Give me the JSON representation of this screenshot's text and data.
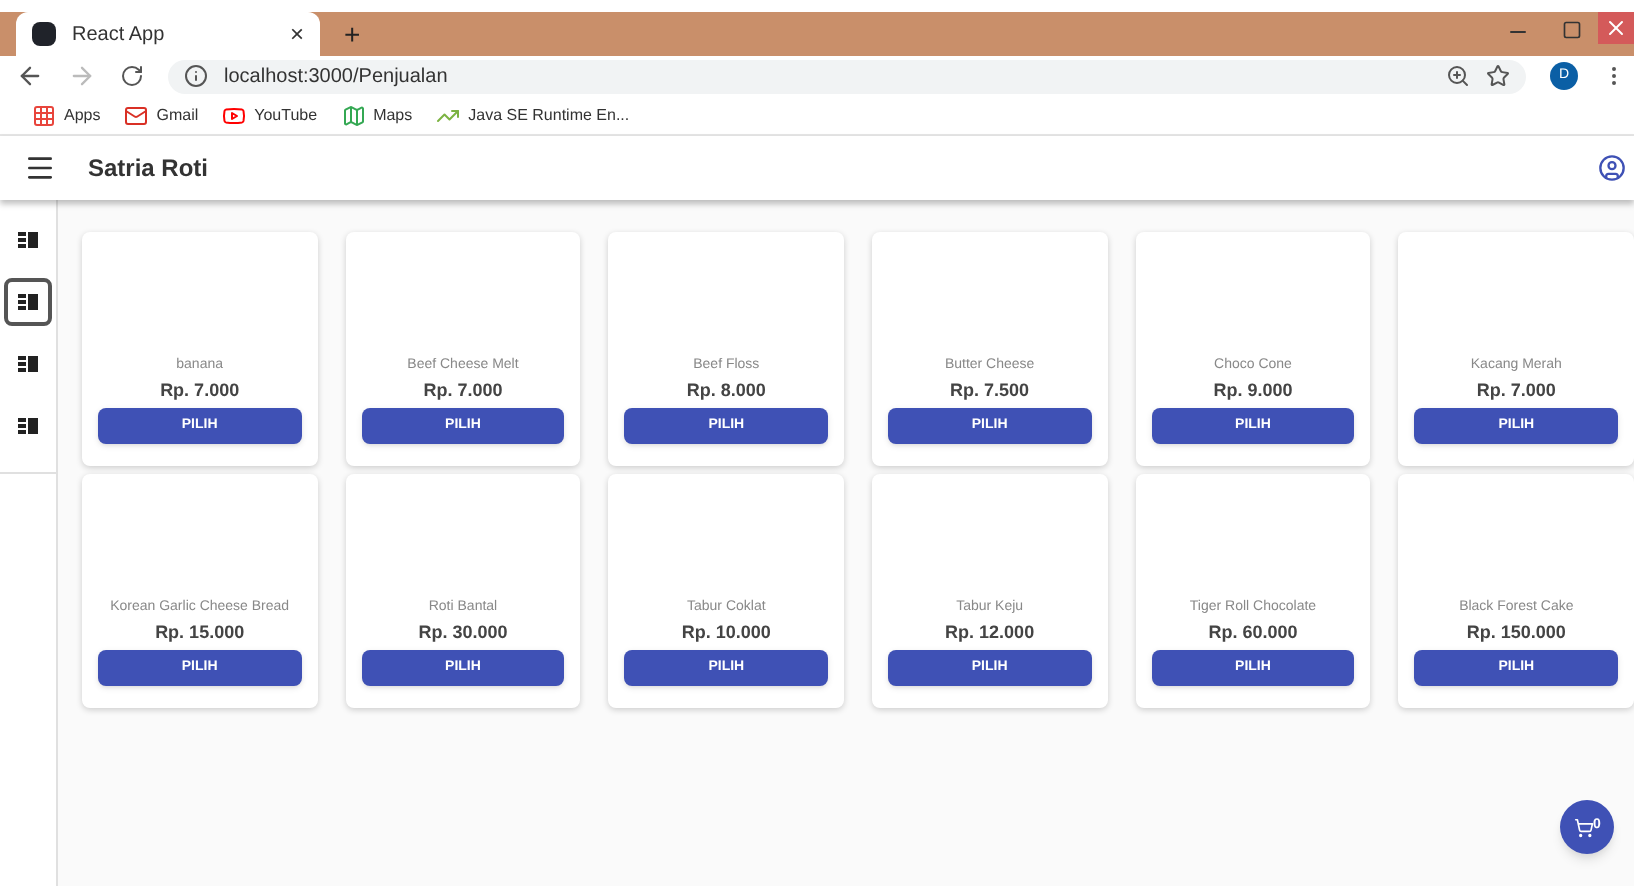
{
  "browser": {
    "tab_title": "React App",
    "tab_close": "×",
    "new_tab": "+",
    "url": "localhost:3000/Penjualan",
    "profile": "D",
    "bookmarks": [
      {
        "kind": "apps",
        "label": "Apps"
      },
      {
        "kind": "gmail",
        "label": "Gmail"
      },
      {
        "kind": "youtube",
        "label": "YouTube"
      },
      {
        "kind": "maps",
        "label": "Maps"
      },
      {
        "kind": "java",
        "label": "Java SE Runtime En..."
      }
    ]
  },
  "app_bar": {
    "title": "Satria Roti"
  },
  "sidebar": {
    "items": [
      {
        "selected": false
      },
      {
        "selected": true
      },
      {
        "selected": false
      },
      {
        "selected": false
      }
    ]
  },
  "products": [
    {
      "name": "banana",
      "price": "Rp. 7.000",
      "button": "PILIH"
    },
    {
      "name": "Beef Cheese Melt",
      "price": "Rp. 7.000",
      "button": "PILIH"
    },
    {
      "name": "Beef Floss",
      "price": "Rp. 8.000",
      "button": "PILIH"
    },
    {
      "name": "Butter Cheese",
      "price": "Rp. 7.500",
      "button": "PILIH"
    },
    {
      "name": "Choco Cone",
      "price": "Rp. 9.000",
      "button": "PILIH"
    },
    {
      "name": "Kacang Merah",
      "price": "Rp. 7.000",
      "button": "PILIH"
    },
    {
      "name": "Korean Garlic Cheese Bread",
      "price": "Rp. 15.000",
      "button": "PILIH"
    },
    {
      "name": "Roti Bantal",
      "price": "Rp. 30.000",
      "button": "PILIH"
    },
    {
      "name": "Tabur Coklat",
      "price": "Rp. 10.000",
      "button": "PILIH"
    },
    {
      "name": "Tabur Keju",
      "price": "Rp. 12.000",
      "button": "PILIH"
    },
    {
      "name": "Tiger Roll Chocolate",
      "price": "Rp. 60.000",
      "button": "PILIH"
    },
    {
      "name": "Black Forest Cake",
      "price": "Rp. 150.000",
      "button": "PILIH"
    }
  ],
  "cart": {
    "count": "0"
  }
}
